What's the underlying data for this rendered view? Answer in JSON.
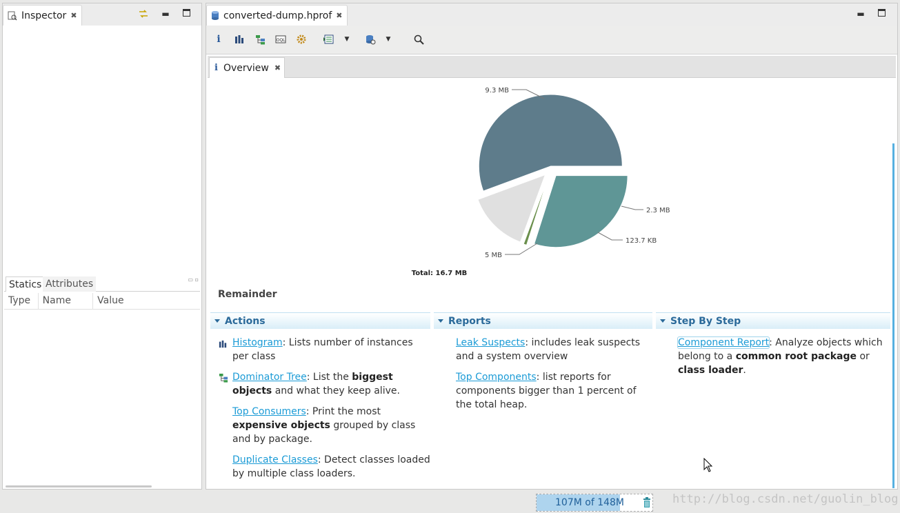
{
  "inspector": {
    "title": "Inspector",
    "tabs": [
      "Statics",
      "Attributes"
    ],
    "columns": [
      "Type",
      "Name",
      "Value"
    ]
  },
  "editor": {
    "file_tab": "converted-dump.hprof",
    "toolbar_icons": [
      "info-icon",
      "histogram-icon",
      "dominator-tree-icon",
      "oql-icon",
      "thread-overview-icon",
      "reports-icon",
      "dropdown-icon",
      "query-browser-icon",
      "dropdown-icon",
      "search-icon"
    ],
    "overview_tab": "Overview"
  },
  "chart_data": {
    "type": "pie",
    "slices": [
      {
        "label": "9.3 MB",
        "value": 9.3,
        "color": "#5e7c8b"
      },
      {
        "label": "5 MB",
        "value": 5.0,
        "color": "#5f9696"
      },
      {
        "label": "123.7 KB",
        "value": 0.12,
        "color": "#6a8f4c"
      },
      {
        "label": "2.3 MB",
        "value": 2.3,
        "color": "#e0e0e0"
      }
    ],
    "total": "Total: 16.7 MB"
  },
  "overview": {
    "remainder_label": "Remainder",
    "actions": {
      "title": "Actions",
      "items": [
        {
          "link": "Histogram",
          "text_parts": [
            {
              "t": ": Lists number of instances per class",
              "b": false
            }
          ]
        },
        {
          "link": "Dominator Tree",
          "text_parts": [
            {
              "t": ": List the ",
              "b": false
            },
            {
              "t": "biggest objects",
              "b": true
            },
            {
              "t": " and what they keep alive.",
              "b": false
            }
          ]
        },
        {
          "link": "Top Consumers",
          "text_parts": [
            {
              "t": ": Print the most ",
              "b": false
            },
            {
              "t": "expensive objects",
              "b": true
            },
            {
              "t": " grouped by class and by package.",
              "b": false
            }
          ]
        },
        {
          "link": "Duplicate Classes",
          "text_parts": [
            {
              "t": ": Detect classes loaded by multiple class loaders.",
              "b": false
            }
          ]
        }
      ]
    },
    "reports": {
      "title": "Reports",
      "items": [
        {
          "link": "Leak Suspects",
          "text_parts": [
            {
              "t": ": includes leak suspects and a system overview",
              "b": false
            }
          ]
        },
        {
          "link": "Top Components",
          "text_parts": [
            {
              "t": ": list reports for components bigger than 1 percent of the total heap.",
              "b": false
            }
          ]
        }
      ]
    },
    "step_by_step": {
      "title": "Step By Step",
      "items": [
        {
          "link": "Component Report",
          "text_parts": [
            {
              "t": ": Analyze objects which belong to a ",
              "b": false
            },
            {
              "t": "common root package",
              "b": true
            },
            {
              "t": " or ",
              "b": false
            },
            {
              "t": "class loader",
              "b": true
            },
            {
              "t": ".",
              "b": false
            }
          ]
        }
      ]
    }
  },
  "status": {
    "heap": "107M of 148M",
    "heap_used_fraction": 0.72,
    "watermark": "http://blog.csdn.net/guolin_blog"
  }
}
